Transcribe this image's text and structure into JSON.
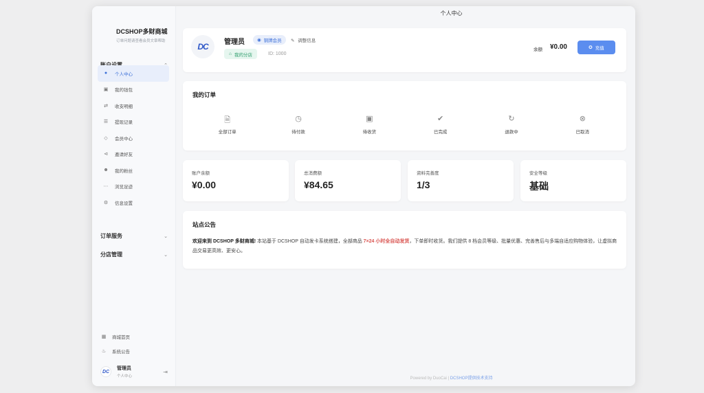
{
  "window": {
    "title": "个人中心"
  },
  "brand": {
    "name": "DCSHOP多财商城",
    "subtitle": "订单问题请查看会员文章帮助"
  },
  "sidebar": {
    "section_account": "账户设置",
    "items": [
      {
        "label": "个人中心",
        "icon": "user-icon",
        "active": true
      },
      {
        "label": "我的钱包",
        "icon": "wallet-icon"
      },
      {
        "label": "收支明细",
        "icon": "exchange-icon"
      },
      {
        "label": "提现记录",
        "icon": "list-icon"
      },
      {
        "label": "会员中心",
        "icon": "diamond-icon"
      },
      {
        "label": "邀请好友",
        "icon": "share-icon"
      },
      {
        "label": "我的粉丝",
        "icon": "users-icon"
      },
      {
        "label": "浏览足迹",
        "icon": "footprint-icon"
      },
      {
        "label": "信息设置",
        "icon": "gear-icon"
      }
    ],
    "section_orders": "订单服务",
    "section_branch": "分店管理",
    "bottom": [
      {
        "label": "商城首页",
        "icon": "store-icon"
      },
      {
        "label": "系统公告",
        "icon": "bell-icon"
      }
    ],
    "user": {
      "name": "管理员",
      "sub": "个人中心"
    }
  },
  "profile": {
    "avatar_text": "DC",
    "name": "管理员",
    "vip": "铜牌会员",
    "edit": "调整信息",
    "store": "我的分店",
    "id": "ID: 1000",
    "balance_label": "余额",
    "balance": "¥0.00",
    "recharge": "充值"
  },
  "orders": {
    "title": "我的订单",
    "items": [
      {
        "label": "全部订单",
        "icon": "document-icon"
      },
      {
        "label": "待付款",
        "icon": "clock-icon"
      },
      {
        "label": "待收货",
        "icon": "box-icon"
      },
      {
        "label": "已完成",
        "icon": "check-circle-icon"
      },
      {
        "label": "退款中",
        "icon": "refresh-icon"
      },
      {
        "label": "已取消",
        "icon": "cancel-circle-icon"
      }
    ]
  },
  "stats": [
    {
      "label": "账户余额",
      "value": "¥0.00"
    },
    {
      "label": "总消费额",
      "value": "¥84.65"
    },
    {
      "label": "资料完善度",
      "value": "1/3"
    },
    {
      "label": "安全等级",
      "value": "基础"
    }
  ],
  "notice": {
    "title": "站点公告",
    "lead": "欢迎来到 DCSHOP 多财商城!",
    "text1": " 本站基于 DCSHOP 自动发卡系统搭建，全部商品 ",
    "highlight": "7×24 小时全自动发货",
    "text2": "，下单即时收货。我们提供 8 档会员等级、批量优惠、完善售后与多端自适应购物体验，让虚拟商品交易更高效、更安心。"
  },
  "footer": {
    "powered": "Powered by DuoCai | ",
    "link": "DCSHOP提供技术支持"
  },
  "colors": {
    "accent": "#5b8def",
    "success": "#2e9d6c",
    "highlight": "#d9534f"
  }
}
